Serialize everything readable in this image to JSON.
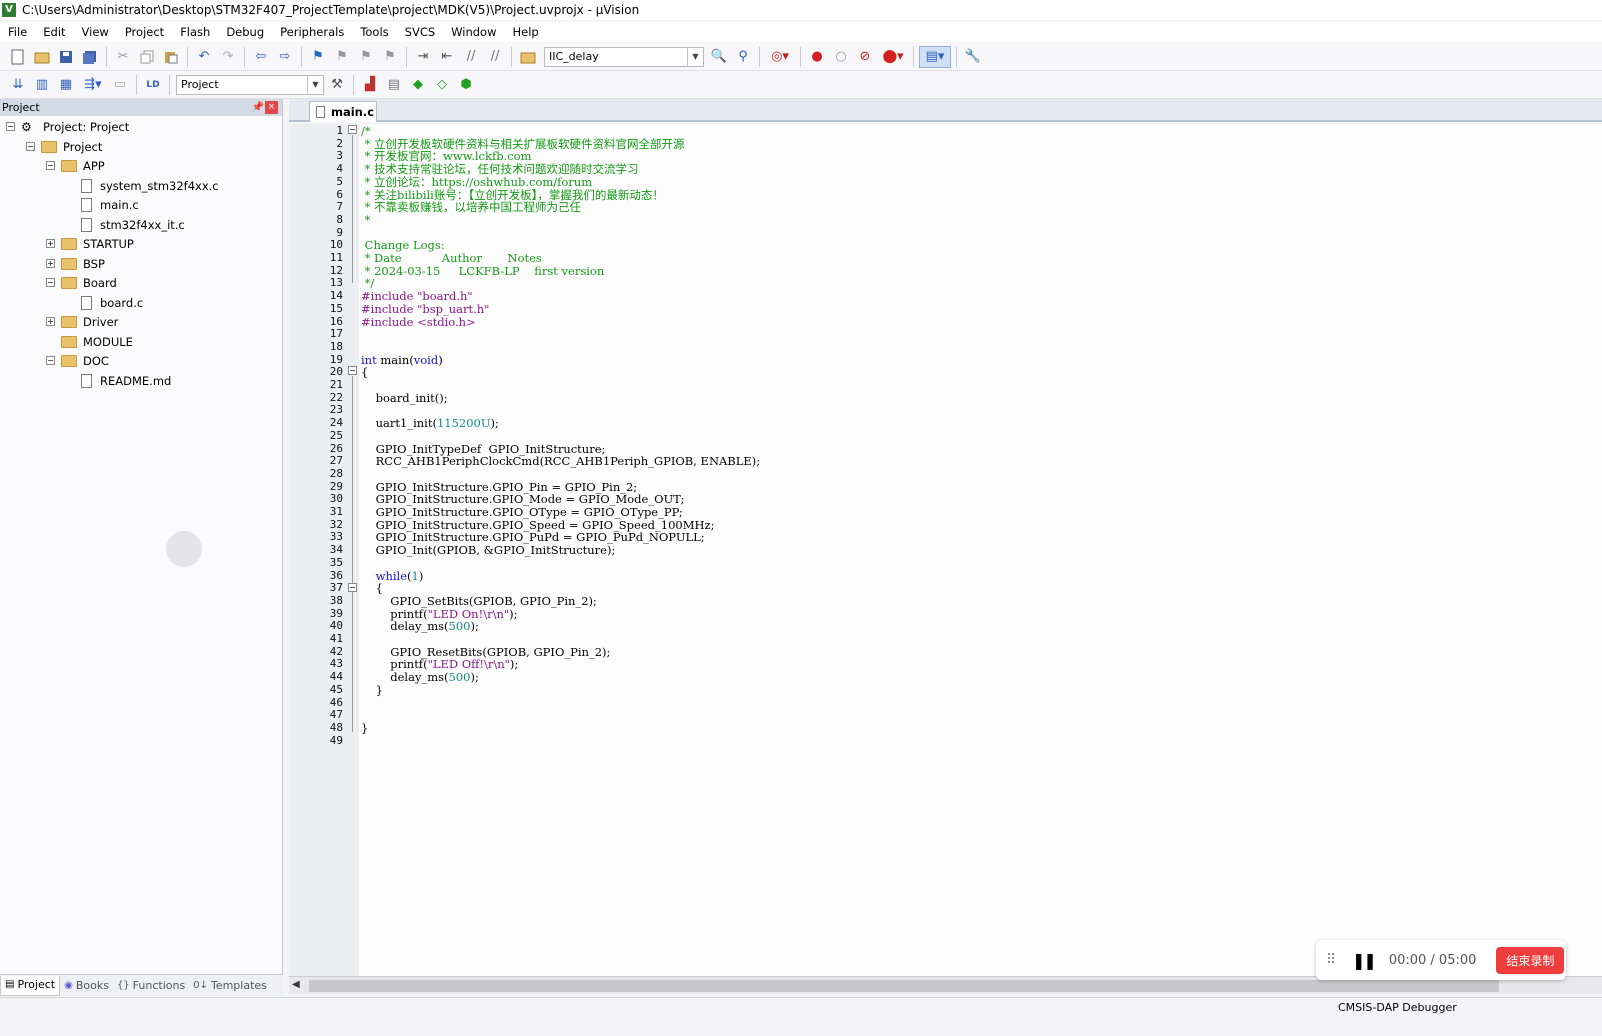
{
  "window": {
    "title": "C:\\Users\\Administrator\\Desktop\\STM32F407_ProjectTemplate\\project\\MDK(V5)\\Project.uvprojx - µVision",
    "app_icon": "V"
  },
  "menubar": {
    "items": [
      "File",
      "Edit",
      "View",
      "Project",
      "Flash",
      "Debug",
      "Peripherals",
      "Tools",
      "SVCS",
      "Window",
      "Help"
    ]
  },
  "toolbar1": {
    "combo_value": "IIC_delay"
  },
  "toolbar2": {
    "target_value": "Project"
  },
  "project_panel": {
    "title": "Project",
    "pin_glyph": "📌",
    "close_glyph": "×",
    "tree": [
      {
        "label": "Project: Project",
        "expander": "−"
      },
      {
        "label": "Project",
        "expander": "−"
      },
      {
        "label": "APP",
        "expander": "−"
      },
      {
        "label": "system_stm32f4xx.c"
      },
      {
        "label": "main.c"
      },
      {
        "label": "stm32f4xx_it.c"
      },
      {
        "label": "STARTUP",
        "expander": "+"
      },
      {
        "label": "BSP",
        "expander": "+"
      },
      {
        "label": "Board",
        "expander": "−"
      },
      {
        "label": "board.c"
      },
      {
        "label": "Driver",
        "expander": "+"
      },
      {
        "label": "MODULE"
      },
      {
        "label": "DOC",
        "expander": "−"
      },
      {
        "label": "README.md"
      }
    ],
    "tabs": [
      "Project",
      "Books",
      "Functions",
      "Templates"
    ],
    "tab_glyphs": [
      "▤",
      "◉",
      "{}",
      "0↓"
    ]
  },
  "editor": {
    "tab_label": "main.c",
    "lines": [
      {
        "n": "1",
        "t": "/*",
        "c": "c-comment"
      },
      {
        "n": "2",
        "t": " * 立创开发板软硬件资料与相关扩展板软硬件资料官网全部开源",
        "c": "c-comment"
      },
      {
        "n": "3",
        "t": " * 开发板官网：www.lckfb.com",
        "c": "c-comment"
      },
      {
        "n": "4",
        "t": " * 技术支持常驻论坛，任何技术问题欢迎随时交流学习",
        "c": "c-comment"
      },
      {
        "n": "5",
        "t": " * 立创论坛：https://oshwhub.com/forum",
        "c": "c-comment"
      },
      {
        "n": "6",
        "t": " * 关注bilibili账号：【立创开发板】，掌握我们的最新动态！",
        "c": "c-comment"
      },
      {
        "n": "7",
        "t": " * 不靠卖板赚钱，以培养中国工程师为己任",
        "c": "c-comment"
      },
      {
        "n": "8",
        "t": " *",
        "c": "c-comment"
      },
      {
        "n": "9",
        "t": "",
        "c": "c-comment"
      },
      {
        "n": "10",
        "t": " Change Logs:",
        "c": "c-comment"
      },
      {
        "n": "11",
        "t": " * Date           Author       Notes",
        "c": "c-comment"
      },
      {
        "n": "12",
        "t": " * 2024-03-15     LCKFB-LP    first version",
        "c": "c-comment"
      },
      {
        "n": "13",
        "t": " */",
        "c": "c-comment"
      },
      {
        "n": "14",
        "t": "#include \"board.h\"",
        "c": "c-inc"
      },
      {
        "n": "15",
        "t": "#include \"bsp_uart.h\"",
        "c": "c-inc"
      },
      {
        "n": "16",
        "t": "#include <stdio.h>",
        "c": "c-inc"
      },
      {
        "n": "17",
        "t": "",
        "c": ""
      },
      {
        "n": "18",
        "t": "",
        "c": ""
      },
      {
        "n": "19",
        "t": "int main(void)",
        "c": ""
      },
      {
        "n": "20",
        "t": "{",
        "c": ""
      },
      {
        "n": "21",
        "t": "",
        "c": ""
      },
      {
        "n": "22",
        "t": "    board_init();",
        "c": ""
      },
      {
        "n": "23",
        "t": "",
        "c": ""
      },
      {
        "n": "24",
        "t": "    uart1_init(115200U);",
        "c": ""
      },
      {
        "n": "25",
        "t": "",
        "c": ""
      },
      {
        "n": "26",
        "t": "    GPIO_InitTypeDef  GPIO_InitStructure;",
        "c": ""
      },
      {
        "n": "27",
        "t": "    RCC_AHB1PeriphClockCmd(RCC_AHB1Periph_GPIOB, ENABLE);",
        "c": ""
      },
      {
        "n": "28",
        "t": "",
        "c": ""
      },
      {
        "n": "29",
        "t": "    GPIO_InitStructure.GPIO_Pin = GPIO_Pin_2;",
        "c": ""
      },
      {
        "n": "30",
        "t": "    GPIO_InitStructure.GPIO_Mode = GPIO_Mode_OUT;",
        "c": ""
      },
      {
        "n": "31",
        "t": "    GPIO_InitStructure.GPIO_OType = GPIO_OType_PP;",
        "c": ""
      },
      {
        "n": "32",
        "t": "    GPIO_InitStructure.GPIO_Speed = GPIO_Speed_100MHz;",
        "c": ""
      },
      {
        "n": "33",
        "t": "    GPIO_InitStructure.GPIO_PuPd = GPIO_PuPd_NOPULL;",
        "c": ""
      },
      {
        "n": "34",
        "t": "    GPIO_Init(GPIOB, &GPIO_InitStructure);",
        "c": ""
      },
      {
        "n": "35",
        "t": "",
        "c": ""
      },
      {
        "n": "36",
        "t": "    while(1)",
        "c": ""
      },
      {
        "n": "37",
        "t": "    {",
        "c": ""
      },
      {
        "n": "38",
        "t": "        GPIO_SetBits(GPIOB, GPIO_Pin_2);",
        "c": ""
      },
      {
        "n": "39",
        "t": "        printf(\"LED On!\\r\\n\");",
        "c": ""
      },
      {
        "n": "40",
        "t": "        delay_ms(500);",
        "c": ""
      },
      {
        "n": "41",
        "t": "",
        "c": ""
      },
      {
        "n": "42",
        "t": "        GPIO_ResetBits(GPIOB, GPIO_Pin_2);",
        "c": ""
      },
      {
        "n": "43",
        "t": "        printf(\"LED Off!\\r\\n\");",
        "c": ""
      },
      {
        "n": "44",
        "t": "        delay_ms(500);",
        "c": ""
      },
      {
        "n": "45",
        "t": "    }",
        "c": ""
      },
      {
        "n": "46",
        "t": "",
        "c": ""
      },
      {
        "n": "47",
        "t": "",
        "c": ""
      },
      {
        "n": "48",
        "t": "}",
        "c": ""
      },
      {
        "n": "49",
        "t": "",
        "c": ""
      }
    ]
  },
  "statusbar": {
    "debugger": "CMSIS-DAP Debugger"
  },
  "recorder": {
    "drag_glyph": "⠿",
    "pause_glyph": "❚❚",
    "time": "00:00 / 05:00",
    "stop_label": "结束录制"
  },
  "colors": {
    "comment": "#139a13",
    "keyword": "#1010d0",
    "string": "#8b178b",
    "number": "#138b8b",
    "stop_button": "#ef3d3d"
  }
}
